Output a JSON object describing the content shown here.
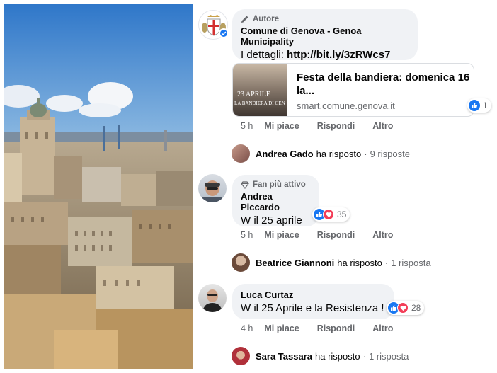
{
  "post_author": {
    "badge": "Autore",
    "name": "Comune di Genova - Genoa Municipality",
    "text_prefix": "I dettagli: ",
    "link_text": "http://bit.ly/3zRWcs7",
    "link_card": {
      "title": "Festa della bandiera: domenica 16 la...",
      "domain": "smart.comune.genova.it",
      "thumb_caption_top": "23 APRILE",
      "thumb_caption_bottom": "LA BANDIERA DI GEN"
    },
    "reaction_count": "1",
    "time": "5 h",
    "like": "Mi piace",
    "reply": "Rispondi",
    "more": "Altro",
    "replies": {
      "name": "Andrea Gado",
      "verb": "ha risposto",
      "count": "9 risposte"
    }
  },
  "comment_1": {
    "badge": "Fan più attivo",
    "name": "Andrea Piccardo",
    "text": "W il 25 aprile",
    "reaction_count": "35",
    "time": "5 h",
    "like": "Mi piace",
    "reply": "Rispondi",
    "more": "Altro",
    "replies": {
      "name": "Beatrice Giannoni",
      "verb": "ha risposto",
      "count": "1 risposta"
    }
  },
  "comment_2": {
    "name": "Luca Curtaz",
    "text": "W il 25 Aprile e la Resistenza !",
    "reaction_count": "28",
    "time": "4 h",
    "like": "Mi piace",
    "reply": "Rispondi",
    "more": "Altro",
    "replies": {
      "name": "Sara Tassara",
      "verb": "ha risposto",
      "count": "1 risposta"
    }
  },
  "colors": {
    "bubble": "#f0f2f5",
    "secondary_text": "#65676b",
    "like_blue": "#1877f2",
    "love_red": "#f33e58"
  }
}
